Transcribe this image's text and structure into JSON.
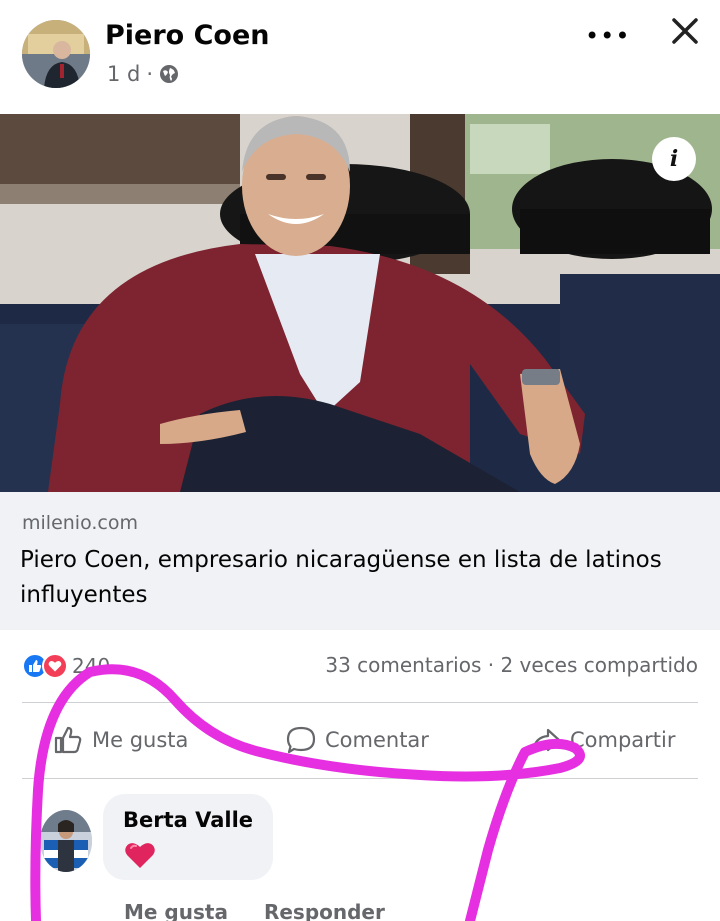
{
  "post": {
    "author": "Piero Coen",
    "age": "1 d",
    "separator": "·",
    "privacy_icon": "globe-icon",
    "more_icon": "ellipsis-icon",
    "more_label": "•••",
    "close_icon": "close-icon"
  },
  "link": {
    "info_label": "i",
    "domain": "milenio.com",
    "headline": "Piero Coen, empresario nicaragüense en lista de latinos influyentes"
  },
  "engagement": {
    "reaction_count": "240",
    "comments_shares": "33 comentarios · 2 veces compartido"
  },
  "actions": {
    "like": "Me gusta",
    "comment": "Comentar",
    "share": "Compartir"
  },
  "comment": {
    "author": "Berta Valle",
    "reaction_icon": "heart-icon",
    "like": "Me gusta",
    "reply": "Responder"
  },
  "colors": {
    "like_blue": "#1877f2",
    "love_red": "#f33e58",
    "scribble_magenta": "#e62fe0"
  }
}
